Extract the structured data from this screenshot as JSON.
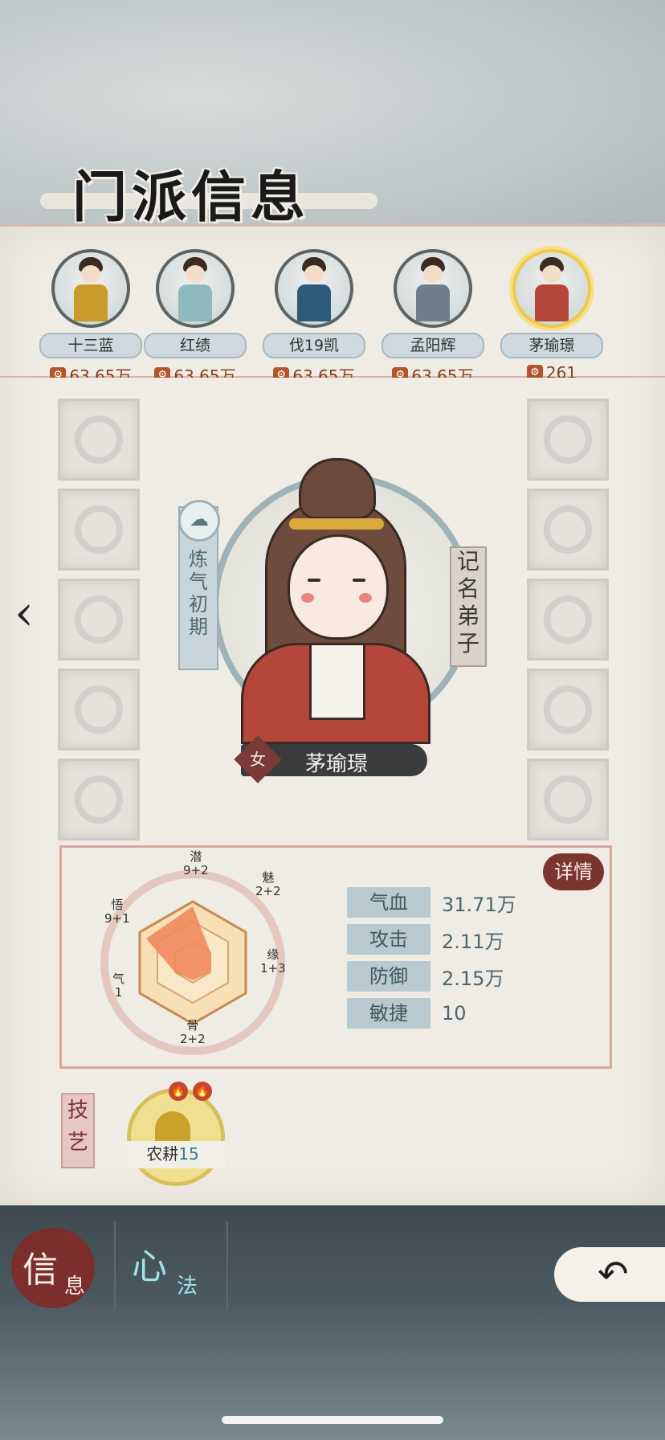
{
  "header": {
    "title": "门派信息"
  },
  "roster": [
    {
      "name": "十三蓝",
      "power": "63.65万",
      "color": "#c99a2c",
      "active": false
    },
    {
      "name": "红绩",
      "power": "63.65万",
      "color": "#8fb8bf",
      "active": false
    },
    {
      "name": "伐19凯",
      "power": "63.65万",
      "color": "#2d5a7a",
      "active": false
    },
    {
      "name": "孟阳辉",
      "power": "63.65万",
      "color": "#6f7f8a",
      "active": false
    },
    {
      "name": "茅瑜璟",
      "power": "261",
      "color": "#b5463a",
      "active": true
    }
  ],
  "character": {
    "name": "茅瑜璟",
    "gender": "女",
    "realm": [
      "炼",
      "气",
      "初",
      "期"
    ],
    "rank": [
      "记",
      "名",
      "弟",
      "子"
    ]
  },
  "attributes": {
    "qian": {
      "label": "潜",
      "value": "9+2"
    },
    "mei": {
      "label": "魅",
      "value": "2+2"
    },
    "yuan": {
      "label": "缘",
      "value": "1+3"
    },
    "gu": {
      "label": "骨",
      "value": "2+2"
    },
    "qi": {
      "label": "气",
      "value": "1"
    },
    "wu": {
      "label": "悟",
      "value": "9+1"
    }
  },
  "stats": [
    {
      "label": "气血",
      "value": "31.71万"
    },
    {
      "label": "攻击",
      "value": "2.11万"
    },
    {
      "label": "防御",
      "value": "2.15万"
    },
    {
      "label": "敏捷",
      "value": "10"
    }
  ],
  "detail_label": "详情",
  "skills": {
    "tag": [
      "技",
      "艺"
    ],
    "items": [
      {
        "name": "农耕",
        "level": "15"
      }
    ]
  },
  "tabs": {
    "info": {
      "big": "信",
      "small": "息"
    },
    "method": {
      "big": "心",
      "small": "法"
    }
  },
  "colors": {
    "accent_red": "#7b2e2c",
    "gold": "#f0c94a",
    "stat_label_bg": "#b9c9d0"
  }
}
